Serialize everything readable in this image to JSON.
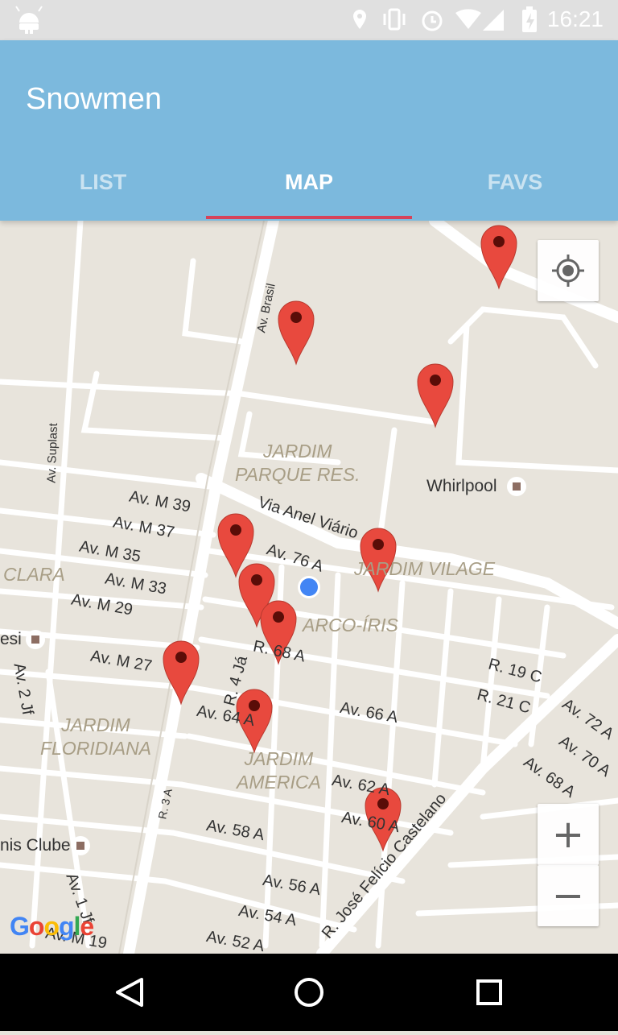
{
  "status_bar": {
    "time": "16:21",
    "icons": [
      "android-icon",
      "location-icon",
      "vibrate-icon",
      "alarm-icon",
      "wifi-icon",
      "signal-icon",
      "battery-icon"
    ]
  },
  "app_bar": {
    "title": "Snowmen",
    "color": "#7cb9dd",
    "tabs": [
      {
        "label": "LIST",
        "active": false
      },
      {
        "label": "MAP",
        "active": true
      },
      {
        "label": "FAVS",
        "active": false
      }
    ],
    "indicator_color": "#d6435a"
  },
  "map": {
    "street_labels": [
      "Av. Brasil",
      "Av. Suplast",
      "Av. M 39",
      "Av. M 37",
      "Av. M 35",
      "Av. M 33",
      "Av. M 29",
      "Av. M 27",
      "Via Anel Viário",
      "Av. 76 A",
      "R. 68 A",
      "R. 4 Já",
      "Av. 64 A",
      "Av. 66 A",
      "Av. 62 A",
      "Av. 60 A",
      "Av. 58 A",
      "Av. 56 A",
      "Av. 54 A",
      "Av. 52 A",
      "R. 19 C",
      "R. 21 C",
      "Av. 72 A",
      "Av. 70 A",
      "Av. 68 A",
      "R. 3 A",
      "Av. 2 Jf",
      "Av. 1 Jf",
      "Av. M 19",
      "R. José Felício Castelano"
    ],
    "area_labels": [
      "JARDIM\nPARQUE RES.",
      "CLARA",
      "JARDIM VILAGE",
      "ARCO-ÍRIS",
      "JARDIM\nFLORIDIANA",
      "JARDIM\nAMERICA"
    ],
    "poi_labels": [
      "Whirlpool",
      "esi",
      "nis Clube"
    ],
    "marker_count": 10,
    "marker_color": "#e8493e",
    "my_location_color": "#4285f4",
    "zoom_in_label": "+",
    "zoom_out_label": "−",
    "attribution": "Google"
  },
  "nav_bar": {
    "buttons": [
      "back-icon",
      "home-icon",
      "recents-icon"
    ]
  }
}
